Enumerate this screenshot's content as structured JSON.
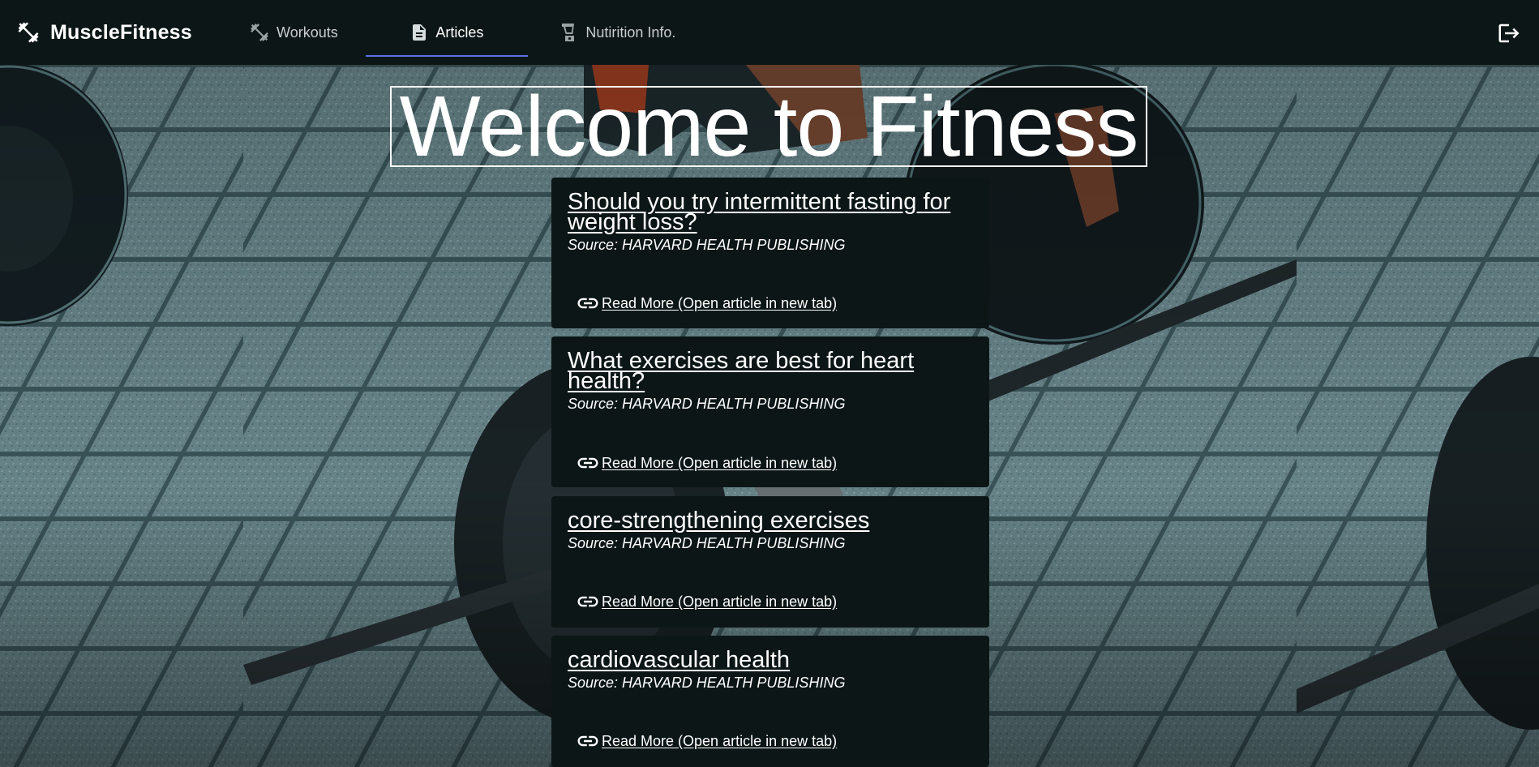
{
  "app": {
    "title": "MuscleFitness"
  },
  "nav": {
    "tabs": [
      {
        "label": "Workouts",
        "icon": "dumbbell-icon",
        "active": false
      },
      {
        "label": "Articles",
        "icon": "article-icon",
        "active": true
      },
      {
        "label": "Nutirition Info.",
        "icon": "blender-icon",
        "active": false
      }
    ],
    "logout_icon": "logout-icon"
  },
  "hero": {
    "title": "Welcome to Fitness"
  },
  "articles": [
    {
      "title": "Should you try intermittent fasting for weight loss?",
      "source": "Source: HARVARD HEALTH PUBLISHING",
      "link_label": "Read More (Open article in new tab)"
    },
    {
      "title": "What exercises are best for heart health?",
      "source": "Source: HARVARD HEALTH PUBLISHING",
      "link_label": "Read More (Open article in new tab)"
    },
    {
      "title": "core-strengthening exercises",
      "source": "Source: HARVARD HEALTH PUBLISHING",
      "link_label": "Read More (Open article in new tab)"
    },
    {
      "title": "cardiovascular health",
      "source": "Source: HARVARD HEALTH PUBLISHING",
      "link_label": "Read More (Open article in new tab)"
    }
  ],
  "colors": {
    "appbar": "#0c1616",
    "card": "#0c1616",
    "tab_indicator": "#5b6ee8",
    "text": "#ffffff"
  }
}
